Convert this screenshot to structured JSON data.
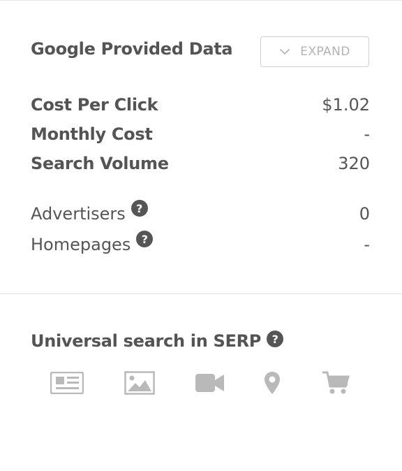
{
  "google_data": {
    "title": "Google Provided Data",
    "expand_label": "EXPAND",
    "metrics": [
      {
        "label": "Cost Per Click",
        "value": "$1.02"
      },
      {
        "label": "Monthly Cost",
        "value": "-"
      },
      {
        "label": "Search Volume",
        "value": "320"
      }
    ],
    "extras": [
      {
        "label": "Advertisers",
        "value": "0"
      },
      {
        "label": "Homepages",
        "value": "-"
      }
    ]
  },
  "serp": {
    "title": "Universal search in SERP",
    "icons": [
      "news-icon",
      "image-icon",
      "video-icon",
      "map-pin-icon",
      "shopping-cart-icon"
    ]
  },
  "colors": {
    "text": "#555555",
    "muted_icon": "#b9b9b9",
    "border": "#cfcfcf"
  }
}
